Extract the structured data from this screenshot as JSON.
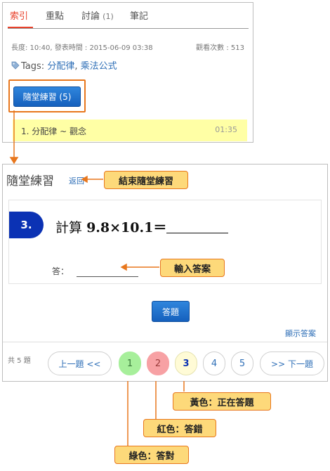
{
  "tabs": [
    {
      "label": "索引",
      "count": ""
    },
    {
      "label": "重點",
      "count": ""
    },
    {
      "label": "討論",
      "count": "(1)"
    },
    {
      "label": "筆記",
      "count": ""
    }
  ],
  "video": {
    "meta": "長度: 10:40, 發表時間 : 2015-06-09 03:38",
    "views": "觀看次數 : 513",
    "tags_label": "Tags:",
    "tags": [
      "分配律",
      "乘法公式"
    ],
    "practice_button": "隨堂練習 (5)"
  },
  "chapter": {
    "title": "1. 分配律 ~ 觀念",
    "time": "01:35"
  },
  "practice": {
    "heading": "隨堂練習",
    "back": "返回",
    "question_number": "3.",
    "question_prefix": "計算",
    "question_math": "9.8×10.1＝",
    "answer_label": "答：",
    "answer_value": "",
    "submit": "答題",
    "show_answer": "顯示答案",
    "total": "共 5 題",
    "prev": "上一題 <<",
    "next": ">> 下一題",
    "pages": [
      {
        "n": "1",
        "status": "correct"
      },
      {
        "n": "2",
        "status": "wrong"
      },
      {
        "n": "3",
        "status": "current"
      },
      {
        "n": "4",
        "status": "none"
      },
      {
        "n": "5",
        "status": "none"
      }
    ]
  },
  "callouts": {
    "end_practice": "結束隨堂練習",
    "input_answer": "輸入答案",
    "yellow": "黃色：正在答題",
    "red": "紅色：答錯",
    "green": "綠色：答對"
  },
  "colors": {
    "accent": "#e8402a",
    "button_blue": "#1560bd",
    "correct": "#a7ef9b",
    "wrong": "#f7a1a4",
    "current": "#fffbd6",
    "callout_fill": "#fdd97a",
    "callout_border": "#e8771d"
  }
}
